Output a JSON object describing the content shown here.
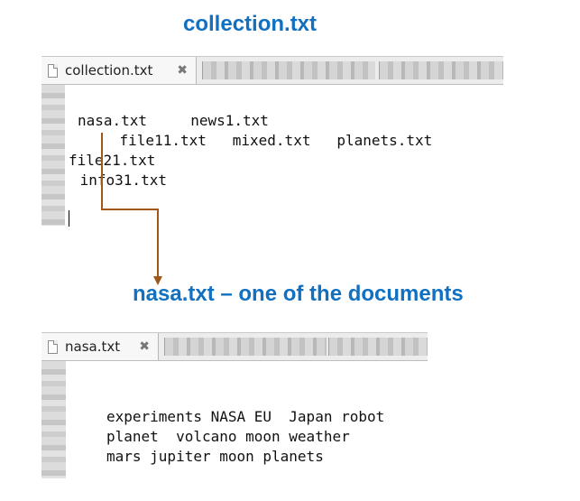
{
  "headings": {
    "top": "collection.txt",
    "middle": "nasa.txt – one of the documents"
  },
  "window1": {
    "tab_label": "collection.txt",
    "close_glyph": "✖",
    "lines": [
      "nasa.txt     news1.txt",
      "    file11.txt   mixed.txt   planets.txt",
      "file21.txt",
      " info31.txt"
    ]
  },
  "window2": {
    "tab_label": "nasa.txt",
    "close_glyph": "✖",
    "lines": [
      "experiments NASA EU  Japan robot",
      "planet  volcano moon weather",
      "mars jupiter moon planets"
    ]
  },
  "colors": {
    "heading": "#1170c0",
    "arrow": "#a0581a"
  },
  "icons": [
    "document-icon",
    "close-icon"
  ]
}
